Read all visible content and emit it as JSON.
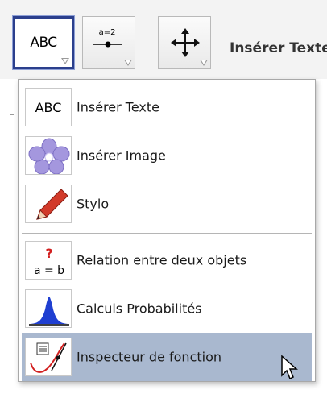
{
  "toolbar": {
    "buttons": [
      {
        "name": "text-tool",
        "label": "ABC",
        "selected": true
      },
      {
        "name": "slider-tool",
        "label": "a=2",
        "selected": false
      },
      {
        "name": "move-graphics-view-tool",
        "label": "",
        "selected": false
      }
    ],
    "active_tool_name": "Insérer Texte"
  },
  "menu": {
    "items": [
      {
        "name": "insert-text",
        "icon_text": "ABC",
        "label": "Insérer Texte",
        "hover": false
      },
      {
        "name": "insert-image",
        "icon_text": "",
        "label": "Insérer Image",
        "hover": false
      },
      {
        "name": "pen",
        "icon_text": "",
        "label": "Stylo",
        "hover": false
      },
      {
        "name": "relation",
        "icon_text": "a = b",
        "label": "Relation entre deux objets",
        "hover": false
      },
      {
        "name": "probability-calculator",
        "icon_text": "",
        "label": "Calculs Probabilités",
        "hover": false
      },
      {
        "name": "function-inspector",
        "icon_text": "",
        "label": "Inspecteur de fonction",
        "hover": true
      }
    ]
  },
  "colors": {
    "selected_border": "#2b3f8c",
    "hover_background": "#a9b8cf",
    "flower": "#9b8fd6",
    "pencil": "#d23a2a",
    "relation_question": "#d21f1f",
    "bell_curve": "#1f3fd1"
  }
}
